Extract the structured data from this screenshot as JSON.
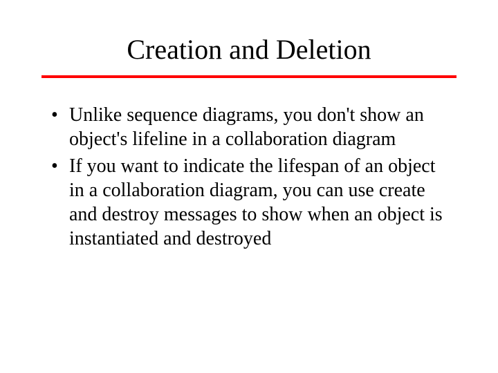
{
  "title": "Creation and Deletion",
  "bullets": [
    "Unlike sequence diagrams, you don't show an object's lifeline in a collaboration diagram",
    "If you want to indicate the lifespan of an object in a collaboration diagram, you can use create and destroy messages to show when an object is instantiated and destroyed"
  ],
  "colors": {
    "rule": "#ff0000"
  }
}
